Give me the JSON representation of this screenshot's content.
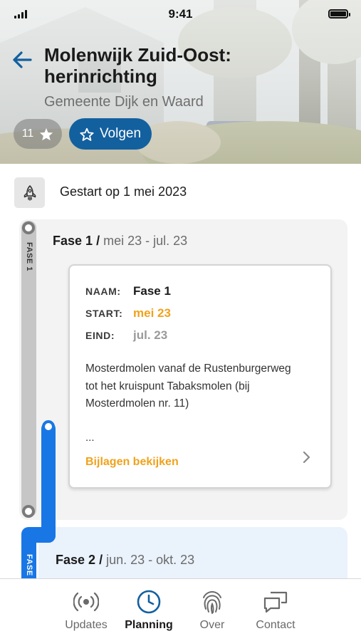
{
  "status_bar": {
    "time": "9:41"
  },
  "header": {
    "title": "Molenwijk Zuid-Oost: herinrichting",
    "subtitle": "Gemeente Dijk en Waard",
    "star_count": "11",
    "follow_label": "Volgen",
    "icons": {
      "back": "arrow-left-icon",
      "star": "star-icon",
      "follow": "star-outline-icon"
    }
  },
  "start": {
    "text": "Gestart op 1 mei 2023",
    "icon": "rocket-icon"
  },
  "timeline": {
    "phases": [
      {
        "rail_label": "FASE 1",
        "title": "Fase 1",
        "separator": "/",
        "range": "mei 23 - jul. 23",
        "details": {
          "naam_label": "NAAM:",
          "naam": "Fase 1",
          "start_label": "START:",
          "start": "mei 23",
          "eind_label": "EIND:",
          "eind": "jul. 23",
          "description": "Mosterdmolen vanaf de Rustenburgerweg tot het kruispunt Tabaksmolen (bij Mosterdmolen nr. 11)",
          "ellipsis": "...",
          "attachments_link": "Bijlagen bekijken"
        }
      },
      {
        "rail_label": "FASE",
        "title": "Fase 2",
        "separator": "/",
        "range": "jun. 23 - okt. 23"
      }
    ]
  },
  "bottom_nav": {
    "active": "Planning",
    "items": [
      {
        "label": "Updates",
        "icon": "broadcast-icon"
      },
      {
        "label": "Planning",
        "icon": "clock-icon"
      },
      {
        "label": "Over",
        "icon": "fingerprint-icon"
      },
      {
        "label": "Contact",
        "icon": "chat-bubbles-icon"
      }
    ]
  },
  "colors": {
    "primary_blue": "#13609f",
    "timeline_blue": "#1877e5",
    "accent_orange": "#f0a21c",
    "start_orange": "#f0a21c",
    "muted_grey": "#9a9a9a",
    "phase2_bg": "#eaf2fc"
  }
}
